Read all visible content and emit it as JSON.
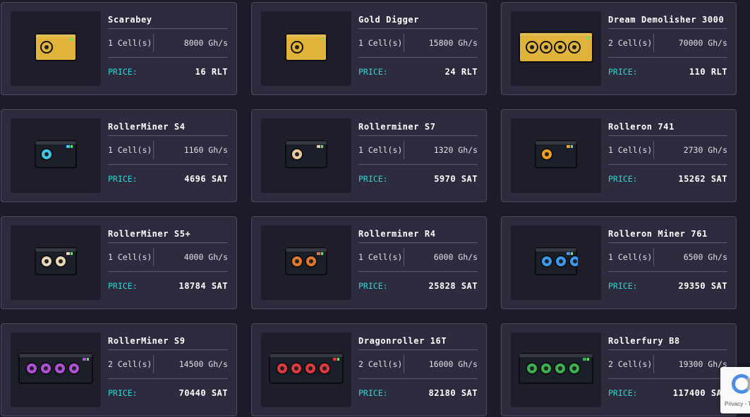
{
  "price_label": "PRICE:",
  "miners": [
    {
      "name": "Scarabey",
      "cells": "1 Cell(s)",
      "power": "8000 Gh/s",
      "price": "16 RLT",
      "icon": "scarabey-miner-icon",
      "color": "#e0b43a"
    },
    {
      "name": "Gold Digger",
      "cells": "1 Cell(s)",
      "power": "15800 Gh/s",
      "price": "24 RLT",
      "icon": "gold-digger-miner-icon",
      "color": "#e0b43a"
    },
    {
      "name": "Dream Demolisher 3000",
      "cells": "2 Cell(s)",
      "power": "70000 Gh/s",
      "price": "110 RLT",
      "icon": "dream-demolisher-miner-icon",
      "color": "#e0b43a"
    },
    {
      "name": "RollerMiner S4",
      "cells": "1 Cell(s)",
      "power": "1160 Gh/s",
      "price": "4696 SAT",
      "icon": "rollerminer-s4-icon",
      "color": "#3fc6e6"
    },
    {
      "name": "Rollerminer S7",
      "cells": "1 Cell(s)",
      "power": "1320 Gh/s",
      "price": "5970 SAT",
      "icon": "rollerminer-s7-icon",
      "color": "#e8c9a0"
    },
    {
      "name": "Rolleron 741",
      "cells": "1 Cell(s)",
      "power": "2730 Gh/s",
      "price": "15262 SAT",
      "icon": "rolleron-741-icon",
      "color": "#f0a020"
    },
    {
      "name": "RollerMiner S5+",
      "cells": "1 Cell(s)",
      "power": "4000 Gh/s",
      "price": "18784 SAT",
      "icon": "rollerminer-s5plus-icon",
      "color": "#e8d8b8"
    },
    {
      "name": "Rollerminer R4",
      "cells": "1 Cell(s)",
      "power": "6000 Gh/s",
      "price": "25828 SAT",
      "icon": "rollerminer-r4-icon",
      "color": "#e07830"
    },
    {
      "name": "Rolleron Miner 761",
      "cells": "1 Cell(s)",
      "power": "6500 Gh/s",
      "price": "29350 SAT",
      "icon": "rolleron-miner-761-icon",
      "color": "#3a9af0"
    },
    {
      "name": "RollerMiner S9",
      "cells": "2 Cell(s)",
      "power": "14500 Gh/s",
      "price": "70440 SAT",
      "icon": "rollerminer-s9-icon",
      "color": "#b050d8"
    },
    {
      "name": "Dragonroller 16T",
      "cells": "2 Cell(s)",
      "power": "16000 Gh/s",
      "price": "82180 SAT",
      "icon": "dragonroller-16t-icon",
      "color": "#e03a40"
    },
    {
      "name": "Rollerfury B8",
      "cells": "2 Cell(s)",
      "power": "19300 Gh/s",
      "price": "117400 SAT",
      "icon": "rollerfury-b8-icon",
      "color": "#3ab050"
    }
  ],
  "recaptcha": {
    "text": "Privacy - T"
  }
}
